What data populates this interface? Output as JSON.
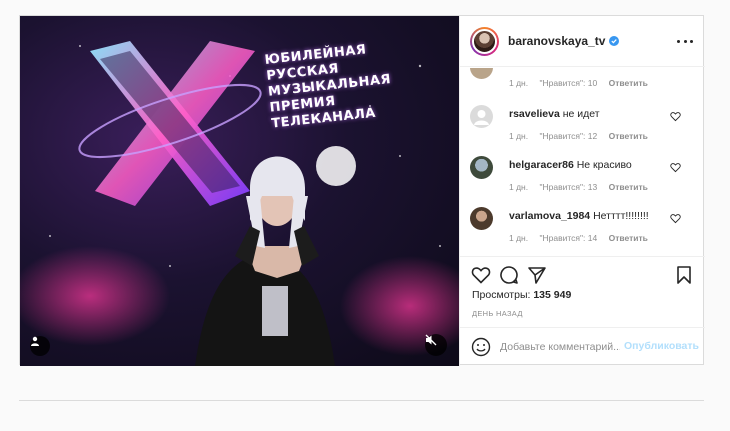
{
  "media": {
    "overlay_text": [
      "Юбилейная",
      "русская",
      "музыкальная",
      "премия",
      "телеканала"
    ],
    "icons": {
      "user_tag": "person-icon",
      "mute": "speaker-muted-icon"
    }
  },
  "post": {
    "author": {
      "username": "baranovskaya_tv",
      "verified": true
    },
    "comments": [
      {
        "username": "",
        "text": "",
        "age": "1 дн.",
        "likes": "\"Нравится\": 10",
        "reply": "Ответить"
      },
      {
        "username": "rsavelieva",
        "text": "не идет",
        "age": "1 дн.",
        "likes": "\"Нравится\": 12",
        "reply": "Ответить"
      },
      {
        "username": "helgaracer86",
        "text": "Не красиво",
        "age": "1 дн.",
        "likes": "\"Нравится\": 13",
        "reply": "Ответить"
      },
      {
        "username": "varlamova_1984",
        "text": "Нетттт!!!!!!!!",
        "age": "1 дн.",
        "likes": "\"Нравится\": 14",
        "reply": "Ответить"
      }
    ],
    "views_label": "Просмотры:",
    "views_count": "135 949",
    "time_ago": "День назад",
    "comment_placeholder": "Добавьте комментарий...",
    "publish_label": "Опубликовать"
  },
  "colors": {
    "link_disabled": "#b2dffc",
    "verified": "#3897f0",
    "muted_text": "#8e8e8e"
  }
}
